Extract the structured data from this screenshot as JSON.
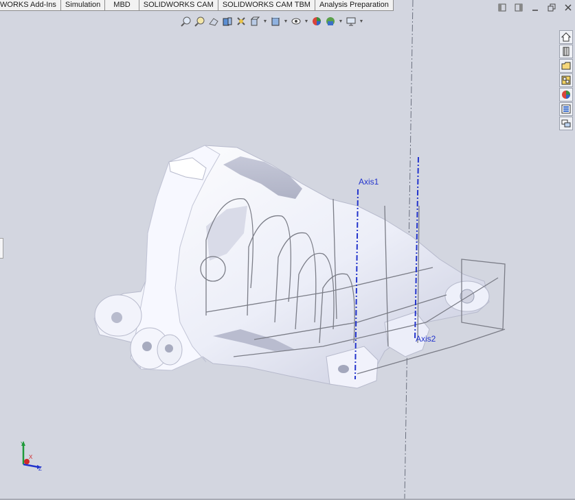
{
  "tabs": [
    {
      "label": "WORKS Add-Ins"
    },
    {
      "label": "Simulation"
    },
    {
      "label": "MBD"
    },
    {
      "label": "SOLIDWORKS CAM"
    },
    {
      "label": "SOLIDWORKS CAM TBM"
    },
    {
      "label": "Analysis Preparation"
    }
  ],
  "hud_icons": [
    "zoom-to-fit-icon",
    "zoom-to-area-icon",
    "previous-view-icon",
    "section-view-icon",
    "dynamic-annotation-icon",
    "view-orientation-icon",
    "display-style-icon",
    "hide-show-items-icon",
    "edit-appearance-icon",
    "apply-scene-icon",
    "view-settings-icon"
  ],
  "task_pane_icons": [
    "home-icon",
    "design-library-icon",
    "file-explorer-icon",
    "view-palette-icon",
    "appearances-icon",
    "custom-properties-icon",
    "forum-icon"
  ],
  "viewport": {
    "axis1_label": "Axis1",
    "axis2_label": "Axis2",
    "triad": {
      "x": "X",
      "y": "Y",
      "z": "Z"
    }
  },
  "colors": {
    "background": "#d3d6e0",
    "part": "#f3f4fc",
    "axis": "#2233cc"
  }
}
